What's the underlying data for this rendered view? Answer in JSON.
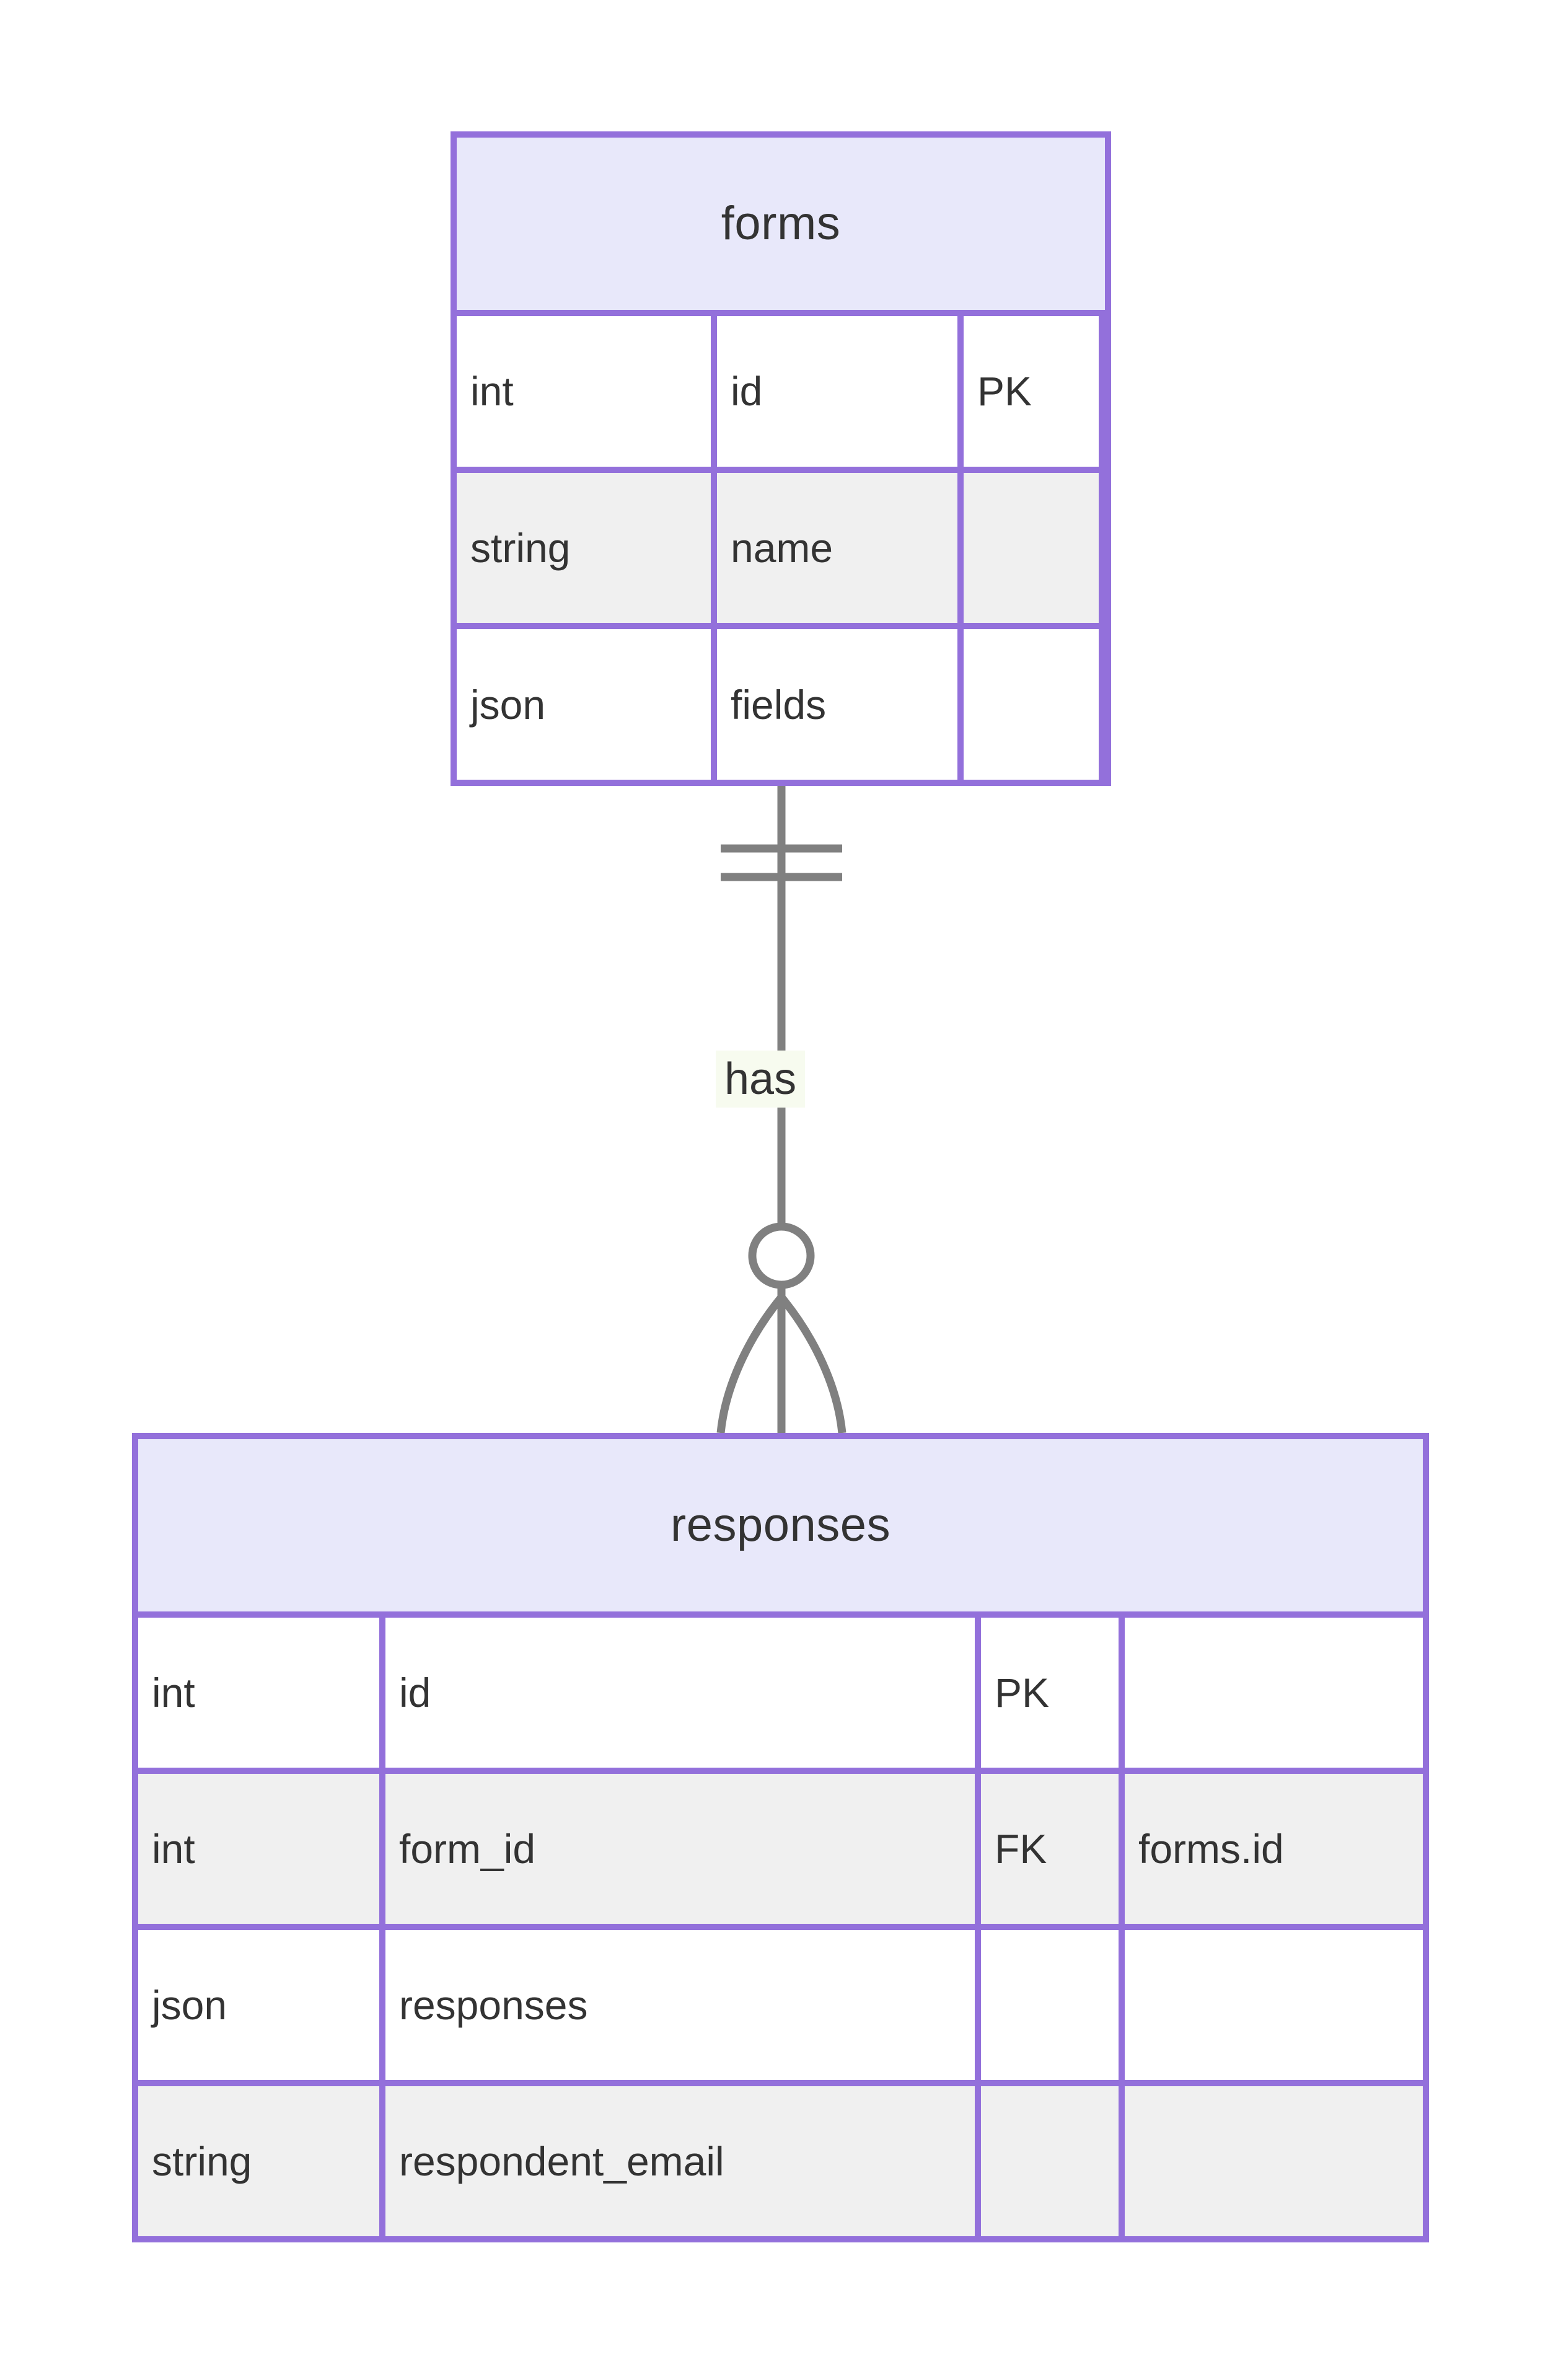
{
  "diagram": {
    "type": "entity-relationship-diagram",
    "colors": {
      "entity_border": "#9370db",
      "entity_header_fill": "#e8e8fa",
      "row_fill": "#ffffff",
      "row_alt_fill": "#f0f0f0",
      "text": "#333333",
      "relationship_line": "#808080",
      "relationship_label_bg": "#f7fbef",
      "background": "#ffffff"
    },
    "entities": [
      {
        "id": "forms",
        "name": "forms",
        "attributes": [
          {
            "type": "int",
            "name": "id",
            "key": "PK",
            "ref": ""
          },
          {
            "type": "string",
            "name": "name",
            "key": "",
            "ref": ""
          },
          {
            "type": "json",
            "name": "fields",
            "key": "",
            "ref": ""
          }
        ]
      },
      {
        "id": "responses",
        "name": "responses",
        "attributes": [
          {
            "type": "int",
            "name": "id",
            "key": "PK",
            "ref": ""
          },
          {
            "type": "int",
            "name": "form_id",
            "key": "FK",
            "ref": "forms.id"
          },
          {
            "type": "json",
            "name": "responses",
            "key": "",
            "ref": ""
          },
          {
            "type": "string",
            "name": "respondent_email",
            "key": "",
            "ref": ""
          }
        ]
      }
    ],
    "relationships": [
      {
        "id": "forms-has-responses",
        "label": "has",
        "from_entity": "forms",
        "to_entity": "responses",
        "from_cardinality": "exactly-one",
        "to_cardinality": "zero-or-more",
        "from_notation": "double-bar",
        "to_notation": "circle-crowsfoot"
      }
    ]
  }
}
